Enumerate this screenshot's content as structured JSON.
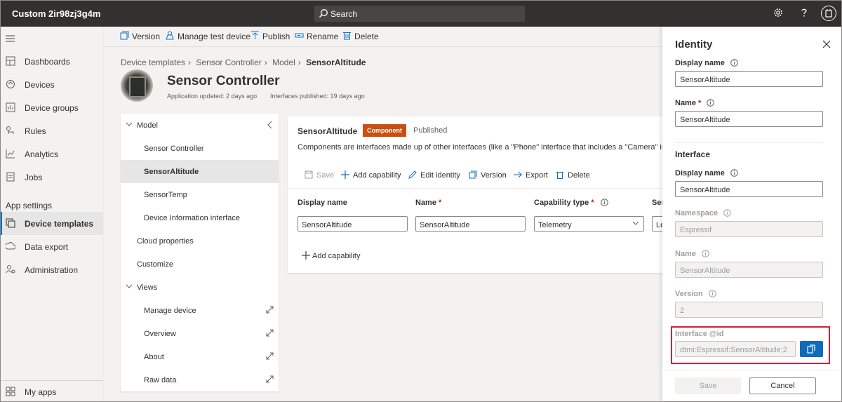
{
  "app": {
    "title": "Custom 2ir98zj3g4m"
  },
  "search": {
    "label": "Search"
  },
  "topbar_icons": [
    "gear-icon",
    "help-icon",
    "avatar-icon"
  ],
  "nav": {
    "items": [
      {
        "label": "Dashboards",
        "icon": "dashboard-icon"
      },
      {
        "label": "Devices",
        "icon": "devices-icon"
      },
      {
        "label": "Device groups",
        "icon": "device-groups-icon"
      },
      {
        "label": "Rules",
        "icon": "rules-icon"
      },
      {
        "label": "Analytics",
        "icon": "analytics-icon"
      },
      {
        "label": "Jobs",
        "icon": "jobs-icon"
      }
    ],
    "section": "App settings",
    "settings_items": [
      {
        "label": "Device templates",
        "icon": "device-templates-icon",
        "active": true
      },
      {
        "label": "Data export",
        "icon": "data-export-icon"
      },
      {
        "label": "Administration",
        "icon": "administration-icon"
      }
    ],
    "bottom": {
      "label": "My apps",
      "icon": "my-apps-icon"
    }
  },
  "commands": [
    "Version",
    "Manage test device",
    "Publish",
    "Rename",
    "Delete"
  ],
  "breadcrumb": [
    "Device templates",
    "Sensor Controller",
    "Model",
    "SensorAltitude"
  ],
  "header": {
    "title": "Sensor Controller",
    "app_updated": "Application updated: 2 days ago",
    "interfaces_published": "Interfaces published: 19 days ago"
  },
  "tree": {
    "model": "Model",
    "items": [
      "Sensor Controller",
      "SensorAltitude",
      "SensorTemp",
      "Device Information interface"
    ],
    "cloud": "Cloud properties",
    "customize": "Customize",
    "views": "Views",
    "view_items": [
      "Manage device",
      "Overview",
      "About",
      "Raw data"
    ]
  },
  "card": {
    "title": "SensorAltitude",
    "badge": "Component",
    "status": "Published",
    "description": "Components are interfaces made up of other interfaces (like a \"Phone\" interface that includes a \"Camera\" interface)",
    "commands": [
      "Save",
      "Add capability",
      "Edit identity",
      "Version",
      "Export",
      "Delete"
    ],
    "columns": [
      "Display name",
      "Name",
      "Capability type",
      "Semantic type"
    ],
    "row": {
      "display_name": "SensorAltitude",
      "name": "SensorAltitude",
      "capability_type": "Telemetry",
      "semantic_type": "Length"
    },
    "add_capability": "Add capability"
  },
  "panel": {
    "title": "Identity",
    "display_name_label": "Display name",
    "display_name_value": "SensorAltitude",
    "name_label": "Name",
    "name_value": "SensorAltitude",
    "interface_section": "Interface",
    "iface_display_name_label": "Display name",
    "iface_display_name_value": "SensorAltitude",
    "namespace_label": "Namespace",
    "namespace_value": "Espressif",
    "iface_name_label": "Name",
    "iface_name_value": "SensorAltitude",
    "version_label": "Version",
    "version_value": "2",
    "interface_id_label": "Interface @id",
    "interface_id_value": "dtmi:Espressif:SensorAltitude;2",
    "save": "Save",
    "cancel": "Cancel"
  },
  "colors": {
    "accent": "#0f6cbd",
    "topbar": "#323130",
    "badge": "#ca5010",
    "highlight": "#d51f3a"
  }
}
